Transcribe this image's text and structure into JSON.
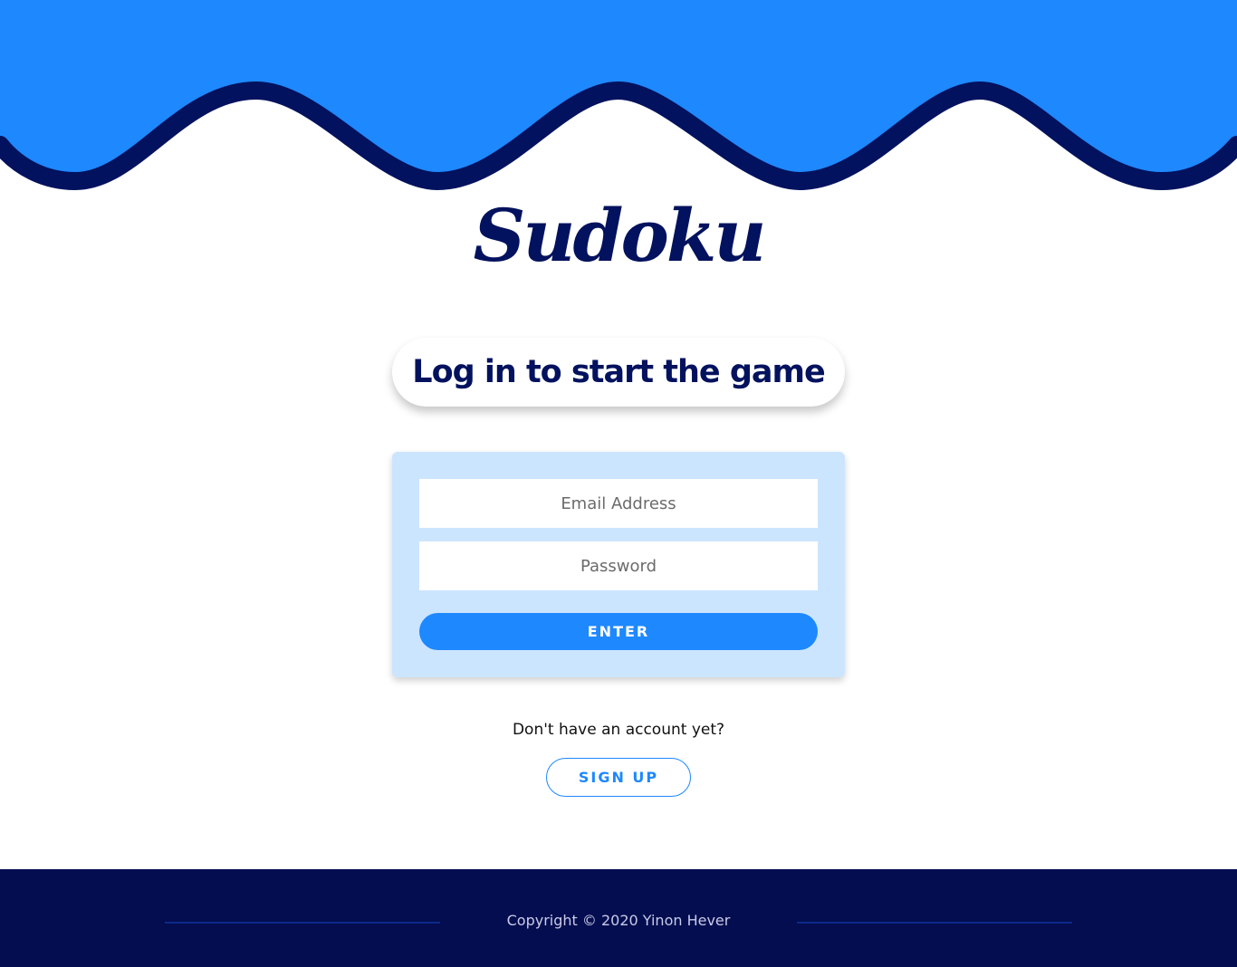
{
  "brand": {
    "logo_text": "Sudoku"
  },
  "colors": {
    "wave_fill": "#1e88ff",
    "wave_stroke": "#03125e",
    "logo": "#03125e",
    "card_bg": "#cce5ff",
    "accent": "#1e88ff",
    "footer_bg": "#030d4f"
  },
  "headline": {
    "text": "Log in to start the game"
  },
  "login_form": {
    "email": {
      "value": "",
      "placeholder": "Email Address"
    },
    "password": {
      "value": "",
      "placeholder": "Password"
    },
    "enter_label": "ENTER"
  },
  "signup": {
    "prompt": "Don't have an account yet?",
    "button_label": "SIGN UP"
  },
  "footer": {
    "copyright": "Copyright © 2020 Yinon Hever"
  }
}
